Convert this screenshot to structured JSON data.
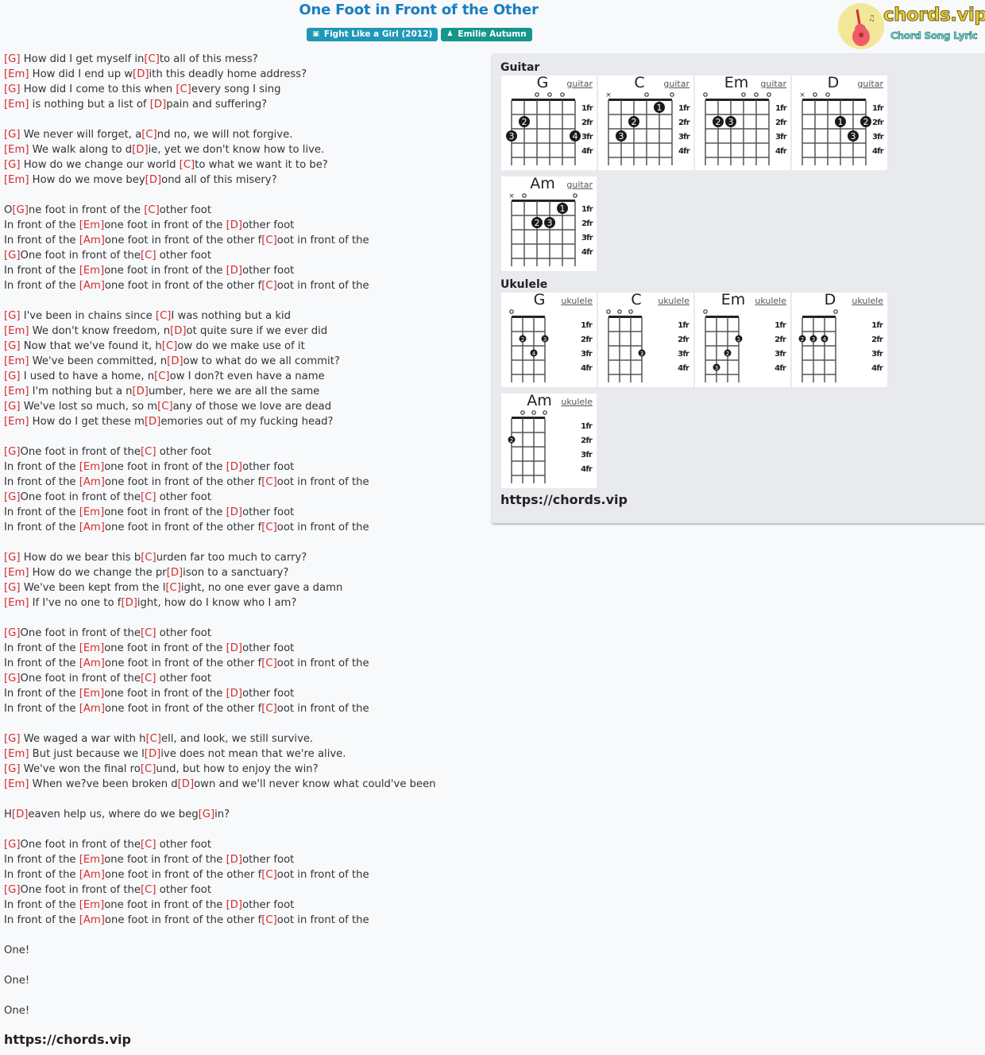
{
  "header": {
    "title": "One Foot in Front of the Other",
    "album_badge": "Fight Like a Girl (2012)",
    "album_icon": "book-icon",
    "artist_badge": "Emilie Autumn",
    "artist_icon": "user-icon"
  },
  "logo": {
    "brand": "chords.vip",
    "tagline": "Chord Song Lyric",
    "icon": "guitar-icon"
  },
  "colors": {
    "title": "#1a7fc1",
    "chord": "#d32d2d",
    "album_badge": "#1e98b5",
    "artist_badge": "#13968b",
    "panel_bg": "#e8eaed"
  },
  "lyrics": [
    "[G] How did I get myself in[C]to all of this mess?",
    "[Em] How did I end up w[D]ith this deadly home address?",
    "[G] How did I come to this when [C]every song I sing",
    "[Em] is nothing but a list of [D]pain and suffering?",
    "",
    "[G] We never will forget, a[C]nd no, we will not forgive.",
    "[Em] We walk along to d[D]ie, yet we don't know how to live.",
    "[G] How do we change our world [C]to what we want it to be?",
    "[Em] How do we move bey[D]ond all of this misery?",
    "",
    "O[G]ne foot in front of the [C]other foot",
    "In front of the [Em]one foot in front of the [D]other foot",
    "In front of the [Am]one foot in front of the other f[C]oot in front of the",
    "[G]One foot in front of the[C] other foot",
    "In front of the [Em]one foot in front of the [D]other foot",
    "In front of the [Am]one foot in front of the other f[C]oot in front of the",
    "",
    "[G] I've been in chains since [C]I was nothing but a kid",
    "[Em] We don't know freedom, n[D]ot quite sure if we ever did",
    "[G] Now that we've found it, h[C]ow do we make use of it",
    "[Em] We've been committed, n[D]ow to what do we all commit?",
    "[G] I used to have a home, n[C]ow I don?t even have a name",
    "[Em] I'm nothing but a n[D]umber, here we are all the same",
    "[G] We've lost so much, so m[C]any of those we love are dead",
    "[Em] How do I get these m[D]emories out of my fucking head?",
    "",
    "[G]One foot in front of the[C] other foot",
    "In front of the [Em]one foot in front of the [D]other foot",
    "In front of the [Am]one foot in front of the other f[C]oot in front of the",
    "[G]One foot in front of the[C] other foot",
    "In front of the [Em]one foot in front of the [D]other foot",
    "In front of the [Am]one foot in front of the other f[C]oot in front of the",
    "",
    "[G] How do we bear this b[C]urden far too much to carry?",
    "[Em] How do we change the pr[D]ison to a sanctuary?",
    "[G] We've been kept from the l[C]ight, no one ever gave a damn",
    "[Em] If I've no one to f[D]ight, how do I know who I am?",
    "",
    "[G]One foot in front of the[C] other foot",
    "In front of the [Em]one foot in front of the [D]other foot",
    "In front of the [Am]one foot in front of the other f[C]oot in front of the",
    "[G]One foot in front of the[C] other foot",
    "In front of the [Em]one foot in front of the [D]other foot",
    "In front of the [Am]one foot in front of the other f[C]oot in front of the",
    "",
    "[G] We waged a war with h[C]ell, and look, we still survive.",
    "[Em] But just because we l[D]ive does not mean that we're alive.",
    "[G] We've won the final ro[C]und, but how to enjoy the win?",
    "[Em] When we?ve been broken d[D]own and we'll never know what could've been",
    "",
    "H[D]eaven help us, where do we beg[G]in?",
    "",
    "[G]One foot in front of the[C] other foot",
    "In front of the [Em]one foot in front of the [D]other foot",
    "In front of the [Am]one foot in front of the other f[C]oot in front of the",
    "[G]One foot in front of the[C] other foot",
    "In front of the [Em]one foot in front of the [D]other foot",
    "In front of the [Am]one foot in front of the other f[C]oot in front of the",
    "",
    "One!",
    "",
    "One!",
    "",
    "One!"
  ],
  "footer_site": "https://chords.vip",
  "panel": {
    "guitar_heading": "Guitar",
    "ukulele_heading": "Ukulele",
    "site": "https://chords.vip",
    "fret_labels": [
      "1fr",
      "2fr",
      "3fr",
      "4fr"
    ],
    "guitar": [
      {
        "name": "G",
        "label": "guitar",
        "strings": [
          "",
          "",
          "o",
          "o",
          "o",
          ""
        ],
        "dots": [
          {
            "s": 0,
            "f": 3,
            "n": "3"
          },
          {
            "s": 1,
            "f": 2,
            "n": "2"
          },
          {
            "s": 5,
            "f": 3,
            "n": "4"
          }
        ]
      },
      {
        "name": "C",
        "label": "guitar",
        "strings": [
          "x",
          "",
          "",
          "o",
          "",
          "o"
        ],
        "dots": [
          {
            "s": 1,
            "f": 3,
            "n": "3"
          },
          {
            "s": 2,
            "f": 2,
            "n": "2"
          },
          {
            "s": 4,
            "f": 1,
            "n": "1"
          }
        ]
      },
      {
        "name": "Em",
        "label": "guitar",
        "strings": [
          "o",
          "",
          "",
          "o",
          "o",
          "o"
        ],
        "dots": [
          {
            "s": 1,
            "f": 2,
            "n": "2"
          },
          {
            "s": 2,
            "f": 2,
            "n": "3"
          }
        ]
      },
      {
        "name": "D",
        "label": "guitar",
        "strings": [
          "x",
          "o",
          "o",
          "",
          "",
          ""
        ],
        "dots": [
          {
            "s": 3,
            "f": 2,
            "n": "1"
          },
          {
            "s": 4,
            "f": 3,
            "n": "3"
          },
          {
            "s": 5,
            "f": 2,
            "n": "2"
          }
        ]
      },
      {
        "name": "Am",
        "label": "guitar",
        "strings": [
          "x",
          "o",
          "",
          "",
          "",
          "o"
        ],
        "dots": [
          {
            "s": 2,
            "f": 2,
            "n": "2"
          },
          {
            "s": 3,
            "f": 2,
            "n": "3"
          },
          {
            "s": 4,
            "f": 1,
            "n": "1"
          }
        ]
      }
    ],
    "ukulele": [
      {
        "name": "G",
        "label": "ukulele",
        "strings": [
          "o",
          "",
          "",
          ""
        ],
        "dots": [
          {
            "s": 1,
            "f": 2,
            "n": "2"
          },
          {
            "s": 2,
            "f": 3,
            "n": "4"
          },
          {
            "s": 3,
            "f": 2,
            "n": "3"
          }
        ]
      },
      {
        "name": "C",
        "label": "ukulele",
        "strings": [
          "o",
          "o",
          "o",
          ""
        ],
        "dots": [
          {
            "s": 3,
            "f": 3,
            "n": "3"
          }
        ]
      },
      {
        "name": "Em",
        "label": "ukulele",
        "strings": [
          "o",
          "",
          "",
          ""
        ],
        "dots": [
          {
            "s": 1,
            "f": 4,
            "n": "3"
          },
          {
            "s": 2,
            "f": 3,
            "n": "2"
          },
          {
            "s": 3,
            "f": 2,
            "n": "1"
          }
        ]
      },
      {
        "name": "D",
        "label": "ukulele",
        "strings": [
          "",
          "",
          "",
          "o"
        ],
        "dots": [
          {
            "s": 0,
            "f": 2,
            "n": "2"
          },
          {
            "s": 1,
            "f": 2,
            "n": "3"
          },
          {
            "s": 2,
            "f": 2,
            "n": "4"
          }
        ]
      },
      {
        "name": "Am",
        "label": "ukulele",
        "strings": [
          "",
          "o",
          "o",
          "o"
        ],
        "dots": [
          {
            "s": 0,
            "f": 2,
            "n": "2"
          }
        ]
      }
    ]
  }
}
